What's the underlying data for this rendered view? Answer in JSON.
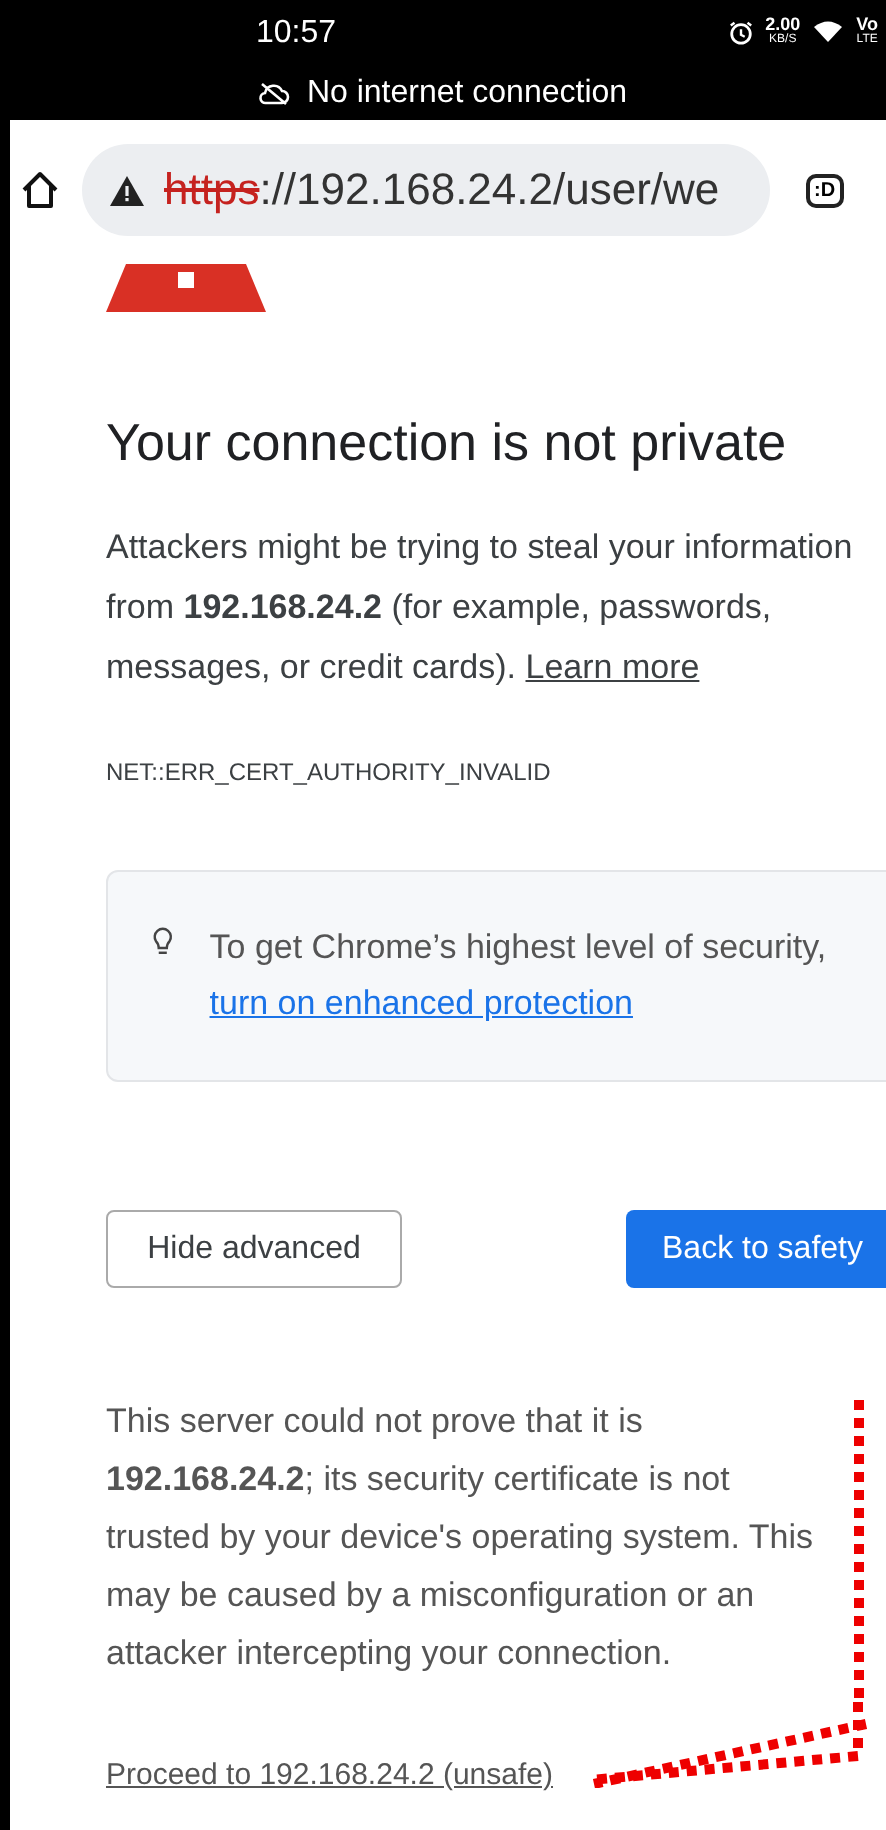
{
  "status_bar": {
    "time": "10:57",
    "speed_value": "2.00",
    "speed_unit": "KB/S",
    "network_top": "Vo",
    "network_bottom": "LTE"
  },
  "offline_banner": {
    "text": "No internet connection"
  },
  "address_bar": {
    "url_scheme": "https",
    "url_rest": "://192.168.24.2/user/we",
    "tab_label": ":D"
  },
  "page": {
    "title": "Your connection is not private",
    "intro": "Attackers might be trying to steal your information from **192.168.24.2** (for example, passwords, messages, or credit cards).",
    "intro_link": "Learn more",
    "error_code": "NET::ERR_CERT_AUTHORITY_INVALID",
    "tip": "To get Chrome’s highest level of security,",
    "tip_link": "turn on enhanced protection",
    "buttons": [
      {
        "label": "Hide advanced",
        "kind": "secondary"
      },
      {
        "label": "Back to safety",
        "kind": "primary"
      }
    ],
    "details": "This server could not prove that it is **192.168.24.2**; its security certificate is not trusted by your device's operating system. This may be caused by a misconfiguration or an attacker intercepting your connection.",
    "proceed_link": "Proceed to 192.168.24.2 (unsafe)"
  }
}
